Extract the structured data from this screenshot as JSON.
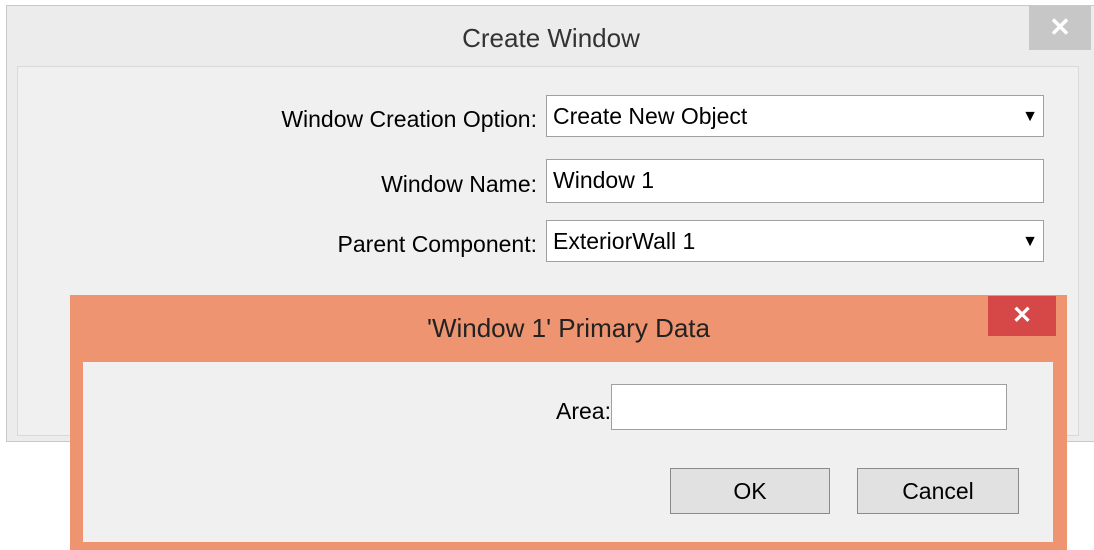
{
  "create_window": {
    "title": "Create Window",
    "close_glyph": "✕",
    "fields": {
      "creation_option_label": "Window Creation Option:",
      "creation_option_value": "Create New Object",
      "window_name_label": "Window Name:",
      "window_name_value": "Window 1",
      "parent_component_label": "Parent Component:",
      "parent_component_value": "ExteriorWall 1"
    },
    "dropdown_glyph": "▼"
  },
  "primary_data": {
    "title": "'Window 1' Primary Data",
    "close_glyph": "✕",
    "area_label": "Area:",
    "area_value": "",
    "ok_label": "OK",
    "cancel_label": "Cancel"
  },
  "colors": {
    "front_frame": "#ee9470",
    "front_close": "#d64848",
    "back_close": "#c7c7c7"
  }
}
